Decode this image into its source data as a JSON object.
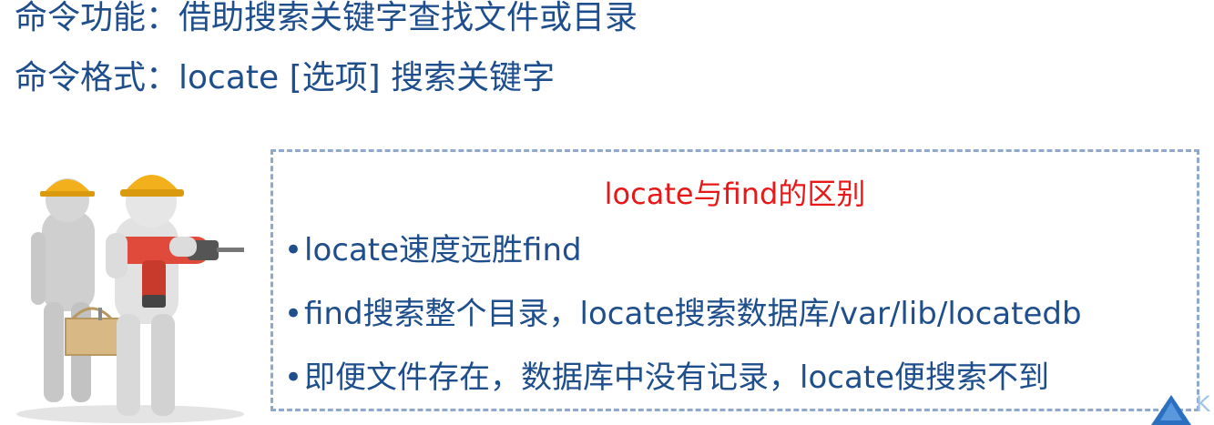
{
  "header": {
    "line1": "命令功能：借助搜索关键字查找文件或目录",
    "line2": "命令格式：locate [选项] 搜索关键字"
  },
  "comparison": {
    "title": "locate与find的区别",
    "bullet_char": "•",
    "bullets": [
      "locate速度远胜find",
      "find搜索整个目录，locate搜索数据库/var/lib/locatedb",
      "即便文件存在，数据库中没有记录，locate便搜索不到"
    ]
  },
  "nav": {
    "k_glyph": "K"
  },
  "colors": {
    "text": "#1f4e8c",
    "title": "#e81818",
    "border": "#8fa8cf",
    "helmet": "#f2b01c"
  },
  "icons": {
    "illustration": "workers-with-drill-illustration",
    "nav": "nav-up-triangle-icon"
  }
}
